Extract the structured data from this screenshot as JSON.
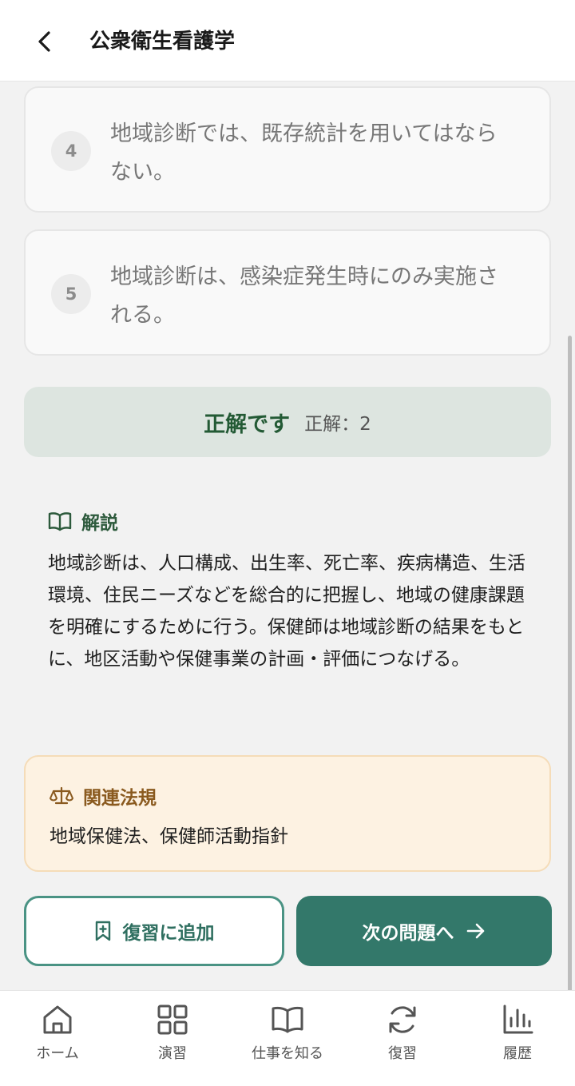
{
  "header": {
    "title": "公衆衛生看護学"
  },
  "choices": [
    {
      "number": "4",
      "text": "地域診断では、既存統計を用いてはならない。"
    },
    {
      "number": "5",
      "text": "地域診断は、感染症発生時にのみ実施される。"
    }
  ],
  "result": {
    "status": "正解です",
    "answer": "正解：2"
  },
  "explanation": {
    "title": "解説",
    "body": "地域診断は、人口構成、出生率、死亡率、疾病構造、生活環境、住民ニーズなどを総合的に把握し、地域の健康課題を明確にするために行う。保健師は地域診断の結果をもとに、地区活動や保健事業の計画・評価につなげる。"
  },
  "law": {
    "title": "関連法規",
    "body": "地域保健法、保健師活動指針"
  },
  "actions": {
    "review_label": "復習に追加",
    "next_label": "次の問題へ"
  },
  "nav": {
    "items": [
      {
        "label": "ホーム",
        "icon": "home-icon"
      },
      {
        "label": "演習",
        "icon": "grid-icon"
      },
      {
        "label": "仕事を知る",
        "icon": "book-icon"
      },
      {
        "label": "復習",
        "icon": "refresh-icon"
      },
      {
        "label": "履歴",
        "icon": "bar-chart-icon"
      }
    ]
  },
  "colors": {
    "primary": "#33786a",
    "correct_bg": "#dde5e0",
    "correct_text": "#235a35",
    "law_bg": "#fdf2e2",
    "law_accent": "#8a5a1f"
  }
}
